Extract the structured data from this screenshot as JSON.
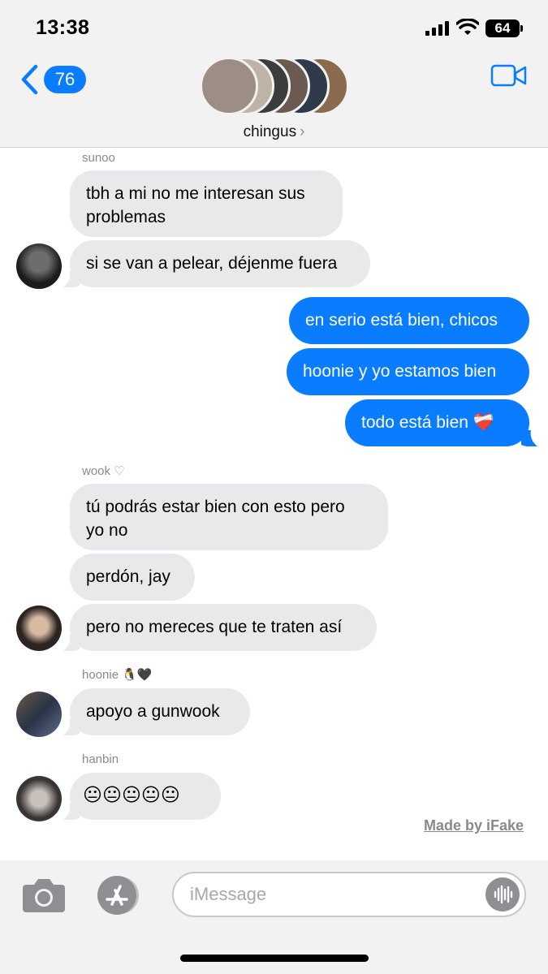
{
  "status": {
    "time": "13:38",
    "battery": "64"
  },
  "header": {
    "back_count": "76",
    "group_name": "chingus",
    "chevron": "›"
  },
  "messages": {
    "sunoo": {
      "name": "sunoo",
      "m1": "tbh a mi no me interesan sus",
      "m1b": "problemas",
      "m2": "si se van a pelear, déjenme fuera"
    },
    "me": {
      "m1": "en serio está bien, chicos",
      "m2": "hoonie y yo estamos bien",
      "m3": "todo está bien ❤️‍🩹"
    },
    "wook": {
      "name": "wook ♡",
      "m1": "tú podrás estar bien con esto pero",
      "m1b": "yo no",
      "m2": "perdón, jay",
      "m3": "pero no mereces que te traten así"
    },
    "hoonie": {
      "name": "hoonie 🐧🖤",
      "m1": "apoyo a gunwook"
    },
    "hanbin": {
      "name": "hanbin",
      "m1": "😐😐😐😐😐"
    }
  },
  "watermark": "Made by iFake",
  "composer": {
    "placeholder": "iMessage"
  },
  "icons": [
    "signal-icon",
    "wifi-icon",
    "battery-icon",
    "back-chevron-icon",
    "video-call-icon",
    "camera-icon",
    "app-store-icon",
    "audio-message-icon"
  ],
  "colors": {
    "accent": "#0a7cff",
    "received": "#e9e9eb",
    "bar": "#f2f2f3"
  }
}
